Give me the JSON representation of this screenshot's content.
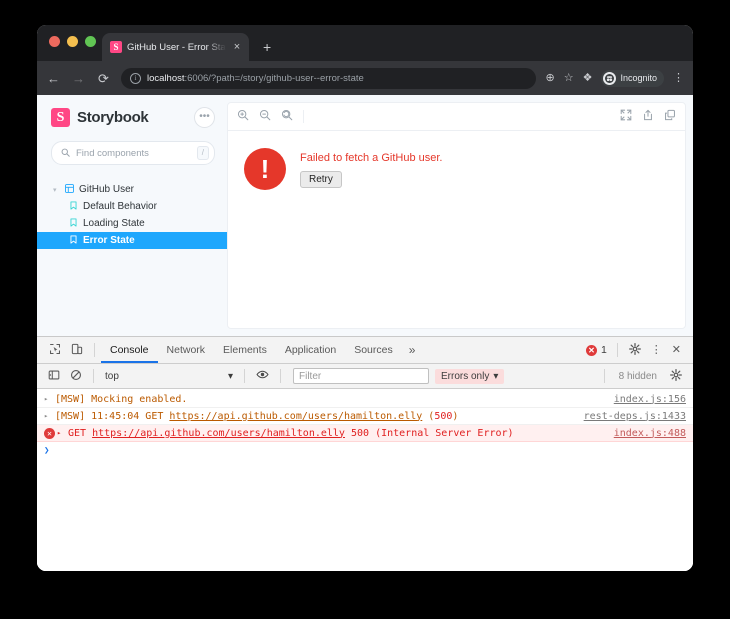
{
  "browser": {
    "tab": {
      "favicon": "storybook-favicon",
      "title": "GitHub User - Error State · Sto",
      "close": "×"
    },
    "newtab_label": "+",
    "nav": {
      "back": "←",
      "forward": "→",
      "reload": "⟳"
    },
    "address": {
      "info_icon": "i",
      "host": "localhost",
      "path": ":6006/?path=/story/github-user--error-state"
    },
    "actions": {
      "zoom_icon": "⊕",
      "bookmark_icon": "☆",
      "extensions_icon": "❖",
      "incognito_label": "Incognito",
      "menu_icon": "⋮"
    }
  },
  "storybook": {
    "logo_letter": "S",
    "brand": "Storybook",
    "menu_button": "•••",
    "search": {
      "placeholder": "Find components",
      "shortcut": "/"
    },
    "tree": [
      {
        "label": "GitHub User",
        "type": "component",
        "level": 0,
        "selected": false,
        "caret": "▾",
        "icon": "component-icon"
      },
      {
        "label": "Default Behavior",
        "type": "story",
        "level": 1,
        "selected": false,
        "icon": "story-icon"
      },
      {
        "label": "Loading State",
        "type": "story",
        "level": 1,
        "selected": false,
        "icon": "story-icon"
      },
      {
        "label": "Error State",
        "type": "story",
        "level": 1,
        "selected": true,
        "icon": "story-icon"
      }
    ],
    "toolbar": {
      "zoom_in": "zoom-in-icon",
      "zoom_out": "zoom-out-icon",
      "zoom_reset": "zoom-reset-icon",
      "fullscreen": "fullscreen-icon",
      "open_new_tab": "open-new-tab-icon",
      "copy_link": "copy-link-icon"
    },
    "preview": {
      "error_glyph": "!",
      "error_message": "Failed to fetch a GitHub user.",
      "retry_label": "Retry",
      "error_color": "#e5372a"
    }
  },
  "devtools": {
    "left_icons": {
      "inspect": "inspect-icon",
      "device": "device-toolbar-icon"
    },
    "tabs": [
      {
        "label": "Console",
        "active": true
      },
      {
        "label": "Network",
        "active": false
      },
      {
        "label": "Elements",
        "active": false
      },
      {
        "label": "Application",
        "active": false
      },
      {
        "label": "Sources",
        "active": false
      }
    ],
    "more_tabs": "»",
    "error_badge_glyph": "✕",
    "error_count": "1",
    "settings_icon": "⚙",
    "menu_icon": "⋮",
    "close_icon": "✕",
    "console_toolbar": {
      "sidebar_toggle": "console-sidebar-icon",
      "clear": "⊘",
      "context": "top",
      "context_caret": "▾",
      "eye_icon": "◉",
      "filter_placeholder": "Filter",
      "level": "Errors only",
      "level_caret": "▾",
      "hidden_count": "8 hidden",
      "console_settings_icon": "⚙"
    },
    "messages": [
      {
        "kind": "warning",
        "expandable": true,
        "parts": [
          {
            "text": "[MSW] Mocking enabled.",
            "style": "plain"
          }
        ],
        "source": "index.js:156"
      },
      {
        "kind": "warning",
        "expandable": true,
        "parts": [
          {
            "text": "[MSW] 11:45:04 GET ",
            "style": "plain"
          },
          {
            "text": "https://api.github.com/users/hamilton.elly",
            "style": "link"
          },
          {
            "text": " (",
            "style": "plain"
          },
          {
            "text": "500",
            "style": "status"
          },
          {
            "text": ")",
            "style": "plain"
          }
        ],
        "source": "rest-deps.js:1433"
      },
      {
        "kind": "error",
        "expandable": true,
        "parts": [
          {
            "text": "GET ",
            "style": "plain"
          },
          {
            "text": "https://api.github.com/users/hamilton.elly",
            "style": "link"
          },
          {
            "text": " 500 (Internal Server Error)",
            "style": "plain"
          }
        ],
        "source": "index.js:488"
      }
    ],
    "prompt": "❯"
  }
}
